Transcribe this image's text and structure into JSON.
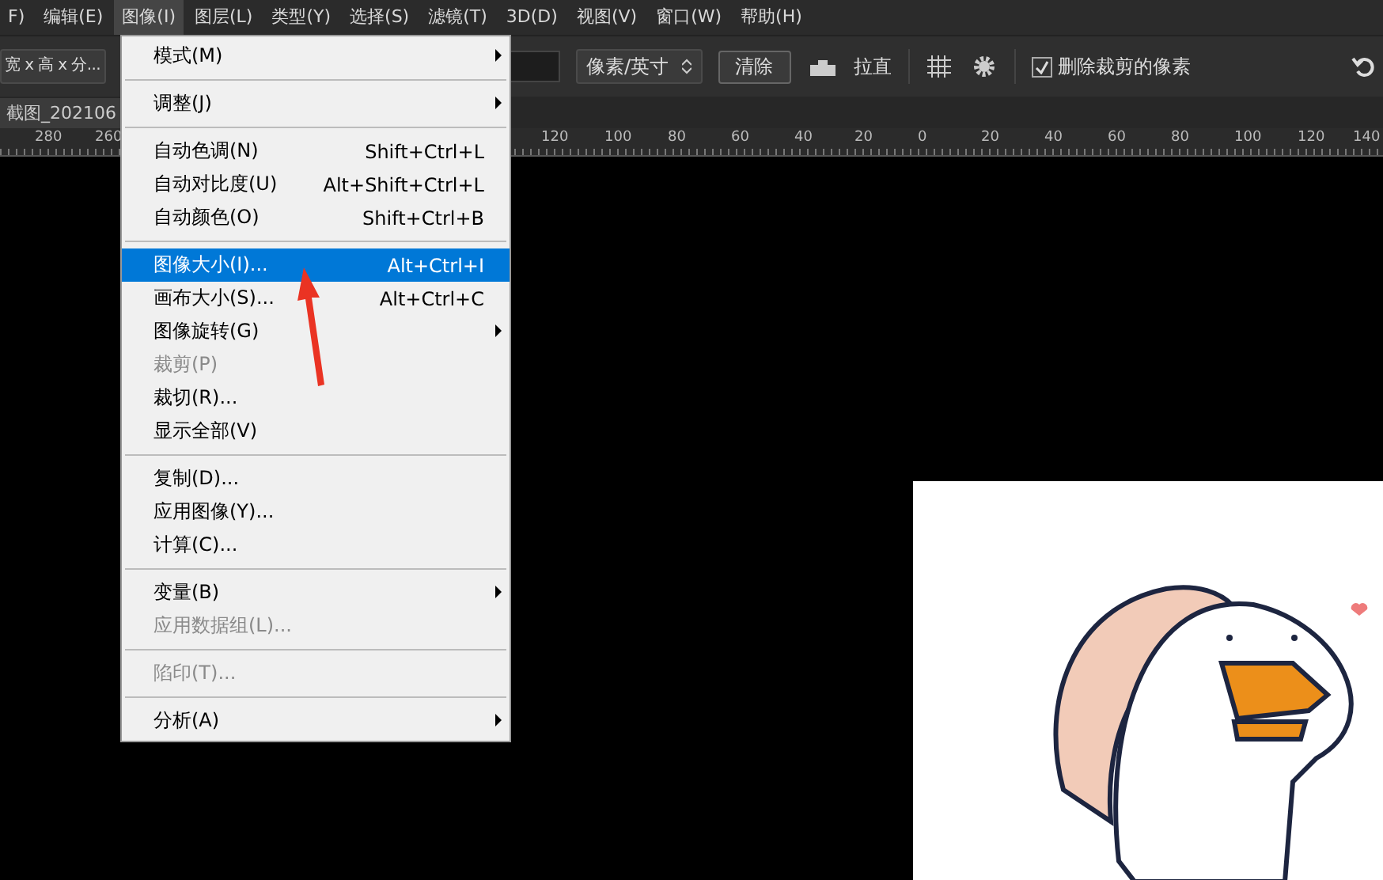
{
  "menu_bar": [
    {
      "label": "F)",
      "selected": false
    },
    {
      "label": "编辑(E)",
      "selected": false
    },
    {
      "label": "图像(I)",
      "selected": true
    },
    {
      "label": "图层(L)",
      "selected": false
    },
    {
      "label": "类型(Y)",
      "selected": false
    },
    {
      "label": "选择(S)",
      "selected": false
    },
    {
      "label": "滤镜(T)",
      "selected": false
    },
    {
      "label": "3D(D)",
      "selected": false
    },
    {
      "label": "视图(V)",
      "selected": false
    },
    {
      "label": "窗口(W)",
      "selected": false
    },
    {
      "label": "帮助(H)",
      "selected": false
    }
  ],
  "options_bar": {
    "ratio_dropdown": "宽 x 高 x 分...",
    "unit_dropdown": "像素/英寸",
    "clear_button": "清除",
    "straighten_label": "拉直",
    "delete_cropped": {
      "label": "删除裁剪的像素",
      "checked": true
    }
  },
  "document_tab": "截图_202106",
  "ruler_labels": [
    "280",
    "260",
    "120",
    "100",
    "80",
    "60",
    "40",
    "20",
    "0",
    "20",
    "40",
    "60",
    "80",
    "100",
    "120",
    "140"
  ],
  "image_menu": [
    {
      "kind": "item",
      "label": "模式(M)",
      "submenu": true,
      "disabled": false,
      "selected": false
    },
    {
      "kind": "separator"
    },
    {
      "kind": "item",
      "label": "调整(J)",
      "submenu": true,
      "disabled": false,
      "selected": false
    },
    {
      "kind": "separator"
    },
    {
      "kind": "item",
      "label": "自动色调(N)",
      "shortcut": "Shift+Ctrl+L",
      "submenu": false,
      "disabled": false,
      "selected": false
    },
    {
      "kind": "item",
      "label": "自动对比度(U)",
      "shortcut": "Alt+Shift+Ctrl+L",
      "submenu": false,
      "disabled": false,
      "selected": false
    },
    {
      "kind": "item",
      "label": "自动颜色(O)",
      "shortcut": "Shift+Ctrl+B",
      "submenu": false,
      "disabled": false,
      "selected": false
    },
    {
      "kind": "separator"
    },
    {
      "kind": "item",
      "label": "图像大小(I)...",
      "shortcut": "Alt+Ctrl+I",
      "submenu": false,
      "disabled": false,
      "selected": true
    },
    {
      "kind": "item",
      "label": "画布大小(S)...",
      "shortcut": "Alt+Ctrl+C",
      "submenu": false,
      "disabled": false,
      "selected": false
    },
    {
      "kind": "item",
      "label": "图像旋转(G)",
      "submenu": true,
      "disabled": false,
      "selected": false
    },
    {
      "kind": "item",
      "label": "裁剪(P)",
      "submenu": false,
      "disabled": true,
      "selected": false
    },
    {
      "kind": "item",
      "label": "裁切(R)...",
      "submenu": false,
      "disabled": false,
      "selected": false
    },
    {
      "kind": "item",
      "label": "显示全部(V)",
      "submenu": false,
      "disabled": false,
      "selected": false
    },
    {
      "kind": "separator"
    },
    {
      "kind": "item",
      "label": "复制(D)...",
      "submenu": false,
      "disabled": false,
      "selected": false
    },
    {
      "kind": "item",
      "label": "应用图像(Y)...",
      "submenu": false,
      "disabled": false,
      "selected": false
    },
    {
      "kind": "item",
      "label": "计算(C)...",
      "submenu": false,
      "disabled": false,
      "selected": false
    },
    {
      "kind": "separator"
    },
    {
      "kind": "item",
      "label": "变量(B)",
      "submenu": true,
      "disabled": false,
      "selected": false
    },
    {
      "kind": "item",
      "label": "应用数据组(L)...",
      "submenu": false,
      "disabled": true,
      "selected": false
    },
    {
      "kind": "separator"
    },
    {
      "kind": "item",
      "label": "陷印(T)...",
      "submenu": false,
      "disabled": true,
      "selected": false
    },
    {
      "kind": "separator"
    },
    {
      "kind": "item",
      "label": "分析(A)",
      "submenu": true,
      "disabled": false,
      "selected": false
    }
  ]
}
